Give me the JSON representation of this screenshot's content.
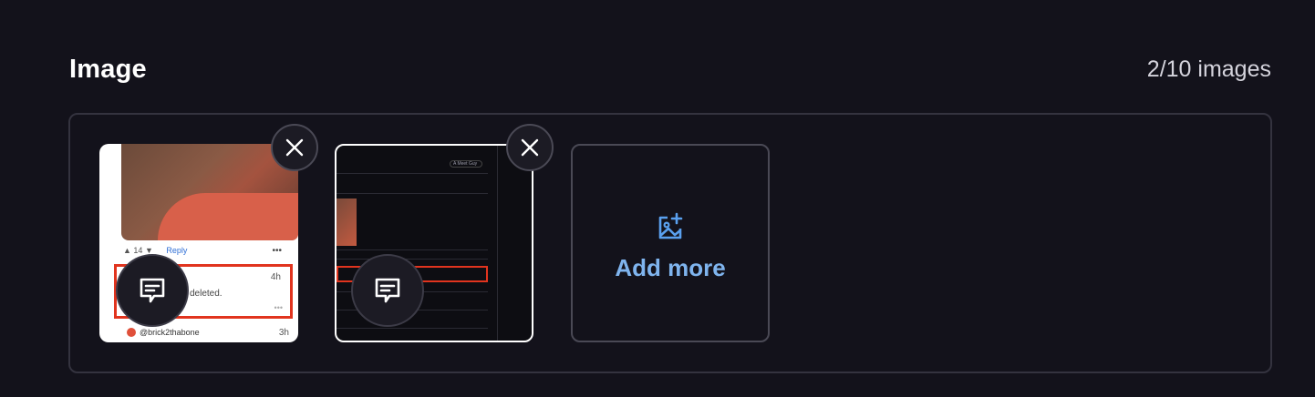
{
  "header": {
    "title": "Image",
    "count": "2/10 images"
  },
  "thumbnails": [
    {
      "id": "thumb1",
      "meta_count": "14",
      "reply": "Reply",
      "time": "4h",
      "snippet": "deleted.",
      "user": "@brick2thabone",
      "time2": "3h"
    },
    {
      "id": "thumb2",
      "pill": "A Meet Guy"
    }
  ],
  "add_more": {
    "label": "Add more"
  },
  "icons": {
    "close": "close-icon",
    "comment": "comment-icon",
    "add_image": "add-image-icon"
  },
  "colors": {
    "accent": "#7fb4ee",
    "icon_blue": "#5aa0ee",
    "highlight_red": "#e1341e"
  }
}
